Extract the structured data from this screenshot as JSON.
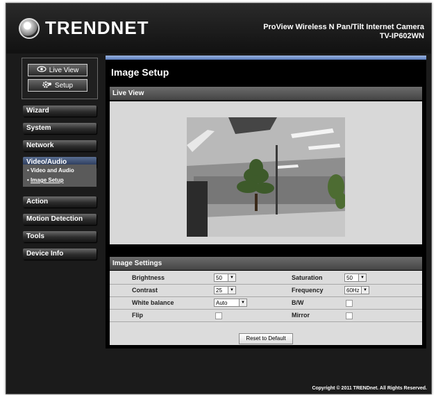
{
  "header": {
    "brand": "TRENDNET",
    "product": "ProView Wireless N Pan/Tilt Internet Camera",
    "model": "TV-IP602WN"
  },
  "quick": {
    "live_view": "Live View",
    "setup": "Setup"
  },
  "menu": {
    "items": [
      {
        "label": "Wizard"
      },
      {
        "label": "System"
      },
      {
        "label": "Network"
      },
      {
        "label": "Video/Audio"
      },
      {
        "label": "Action"
      },
      {
        "label": "Motion Detection"
      },
      {
        "label": "Tools"
      },
      {
        "label": "Device Info"
      }
    ],
    "submenu": [
      {
        "label": "Video and Audio"
      },
      {
        "label": "Image Setup"
      }
    ]
  },
  "main": {
    "title": "Image Setup",
    "live_view_header": "Live View",
    "settings_header": "Image Settings"
  },
  "settings": {
    "brightness": {
      "label": "Brightness",
      "value": "50"
    },
    "saturation": {
      "label": "Saturation",
      "value": "50"
    },
    "contrast": {
      "label": "Contrast",
      "value": "25"
    },
    "frequency": {
      "label": "Frequency",
      "value": "60Hz"
    },
    "white_balance": {
      "label": "White balance",
      "value": "Auto"
    },
    "bw": {
      "label": "B/W",
      "checked": false
    },
    "flip": {
      "label": "Flip",
      "checked": false
    },
    "mirror": {
      "label": "Mirror",
      "checked": false
    },
    "reset_label": "Reset to Default"
  },
  "footer": {
    "copyright": "Copyright © 2011 TRENDnet. All Rights Reserved."
  },
  "colors": {
    "background": "#1b1b1b",
    "accent_bar": "#7a9ad0",
    "section_header": "#555555",
    "panel": "#d8d8d8"
  }
}
